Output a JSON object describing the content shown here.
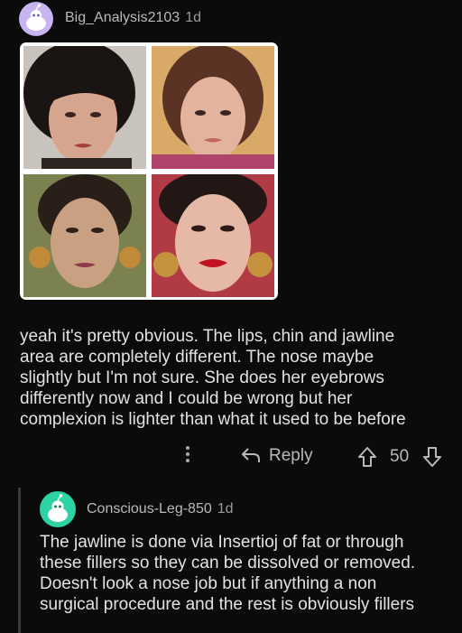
{
  "comment1": {
    "username": "Big_Analysis2103",
    "age": "1d",
    "text_lines": [
      "yeah it's pretty obvious. The lips, chin and jawline",
      "area are completely different. The nose maybe",
      "slightly but I'm not sure. She does her eyebrows",
      "differently now and I could be wrong but her",
      "complexion is lighter than what it used to be before"
    ],
    "actions": {
      "reply_label": "Reply",
      "score": "50"
    }
  },
  "comment2": {
    "username": "Conscious-Leg-850",
    "age": "1d",
    "text_lines": [
      "The jawline is done via Insertioj of fat or through",
      "these fillers so they can be dissolved or removed.",
      "Doesn't look a nose job but if anything a non",
      "surgical procedure and the rest is obviously fillers"
    ]
  },
  "colors": {
    "background": "#0b0b0b",
    "avatar1_bg": "#c8b4f0",
    "avatar2_bg": "#2ed3a4"
  },
  "icons": [
    "snoo-avatar-icon",
    "more-options-icon",
    "reply-arrow-icon",
    "upvote-icon",
    "downvote-icon"
  ]
}
